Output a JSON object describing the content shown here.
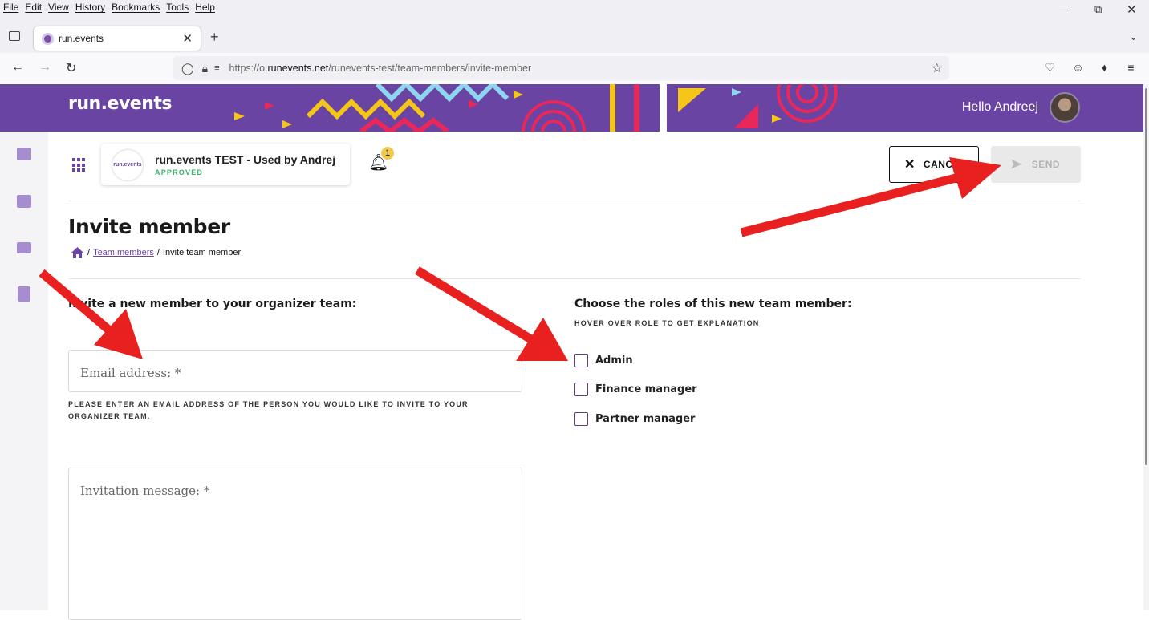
{
  "browser": {
    "menu": [
      "File",
      "Edit",
      "View",
      "History",
      "Bookmarks",
      "Tools",
      "Help"
    ],
    "tab_title": "run.events",
    "url_prefix": "https://o.",
    "url_domain": "runevents.net",
    "url_path": "/runevents-test/team-members/invite-member"
  },
  "header": {
    "logo": "run.events",
    "greeting": "Hello Andreej",
    "brand_color": "#6a44a3"
  },
  "org": {
    "logo_text": "run.events",
    "name": "run.events TEST - Used by Andrej",
    "status": "APPROVED",
    "notification_count": "1"
  },
  "actions": {
    "cancel_label": "CANCEL",
    "send_label": "SEND"
  },
  "page": {
    "title": "Invite member",
    "breadcrumb_link": "Team members",
    "breadcrumb_current": "Invite team member"
  },
  "invite": {
    "title": "Invite a new member to your organizer team:",
    "email_placeholder": "Email address: *",
    "email_hint": "PLEASE ENTER AN EMAIL ADDRESS OF THE PERSON YOU WOULD LIKE TO INVITE TO YOUR ORGANIZER TEAM.",
    "message_placeholder": "Invitation message: *"
  },
  "roles": {
    "title": "Choose the roles of this new team member:",
    "hint": "HOVER OVER ROLE TO GET EXPLANATION",
    "items": [
      "Admin",
      "Finance manager",
      "Partner manager"
    ]
  }
}
